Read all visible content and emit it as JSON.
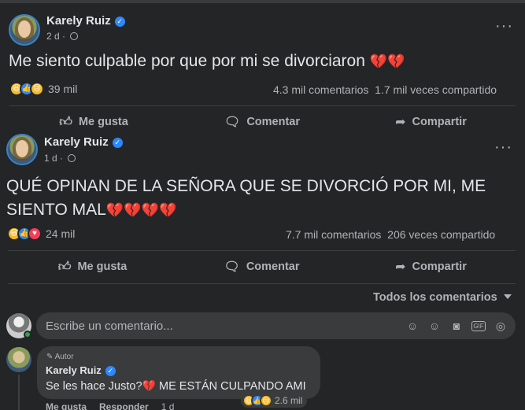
{
  "post1": {
    "author": "Karely Ruiz",
    "time": "2 d",
    "text": "Me siento culpable por que por mi se divorciaron",
    "emojis": "💔💔",
    "reactions_count": "39 mil",
    "comments": "4.3 mil comentarios",
    "shares": "1.7 mil veces compartido"
  },
  "post2": {
    "author": "Karely Ruiz",
    "time": "1 d",
    "text_line1": "QUÉ OPINAN DE LA SEÑORA QUE SE DIVORCIÓ POR MI, ME",
    "text_line2": "SIENTO MAL",
    "emojis": "💔💔💔💔",
    "reactions_count": "24 mil",
    "comments": "7.7 mil comentarios",
    "shares": "206 veces compartido"
  },
  "actions": {
    "like": "Me gusta",
    "comment": "Comentar",
    "share": "Compartir"
  },
  "comments_section": {
    "sort_label": "Todos los comentarios",
    "placeholder": "Escribe un comentario..."
  },
  "comment": {
    "badge": "Autor",
    "author": "Karely Ruiz",
    "text": "Se les hace Justo?",
    "emoji": "💔",
    "text_after": " ME ESTÁN CULPANDO AMI",
    "reactions_count": "2.6 mil",
    "like": "Me gusta",
    "reply": "Responder",
    "time": "1 d"
  },
  "icons": {
    "like": "thumbs-up-icon",
    "comment": "speech-bubble-icon",
    "share": "share-arrow-icon",
    "more": "more-dots-icon",
    "globe": "globe-icon",
    "verified": "verified-badge-icon"
  },
  "colors": {
    "background": "#18191a",
    "card": "#242526",
    "accent": "#2d88ff",
    "heart": "#e0245e"
  }
}
